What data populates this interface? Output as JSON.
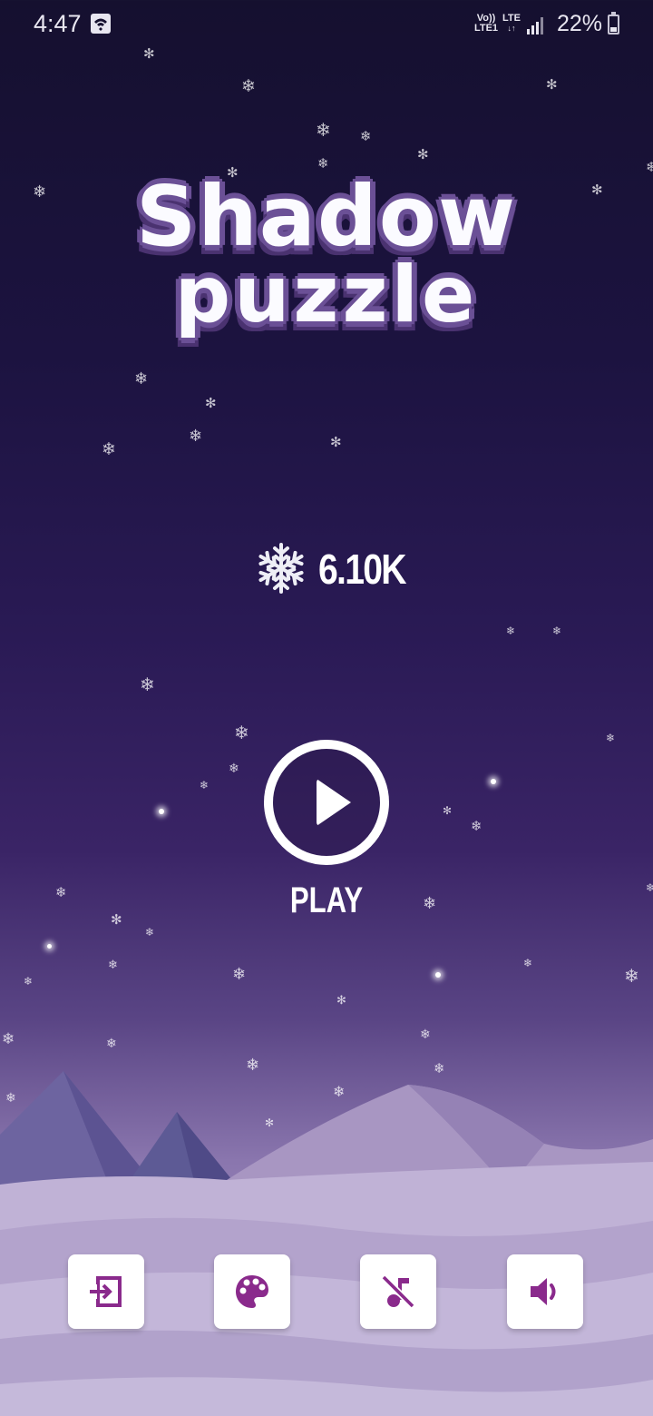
{
  "status_bar": {
    "time": "4:47",
    "volte_line1": "Vo))",
    "volte_line2": "LTE1",
    "lte_label": "LTE",
    "battery_percent": "22%"
  },
  "logo": {
    "line1": "Shadow",
    "line2": "puzzle"
  },
  "score": {
    "value": "6.10K",
    "icon": "snowflake-icon"
  },
  "play": {
    "label": "PLAY",
    "icon": "play-icon"
  },
  "bottom_buttons": [
    {
      "icon": "exit-icon"
    },
    {
      "icon": "palette-icon"
    },
    {
      "icon": "music-off-icon"
    },
    {
      "icon": "volume-icon"
    }
  ],
  "colors": {
    "accent": "#8a2a8c",
    "logo_outline": "#6b5096",
    "background_top": "#15102f",
    "background_bottom": "#b6a6cf"
  }
}
